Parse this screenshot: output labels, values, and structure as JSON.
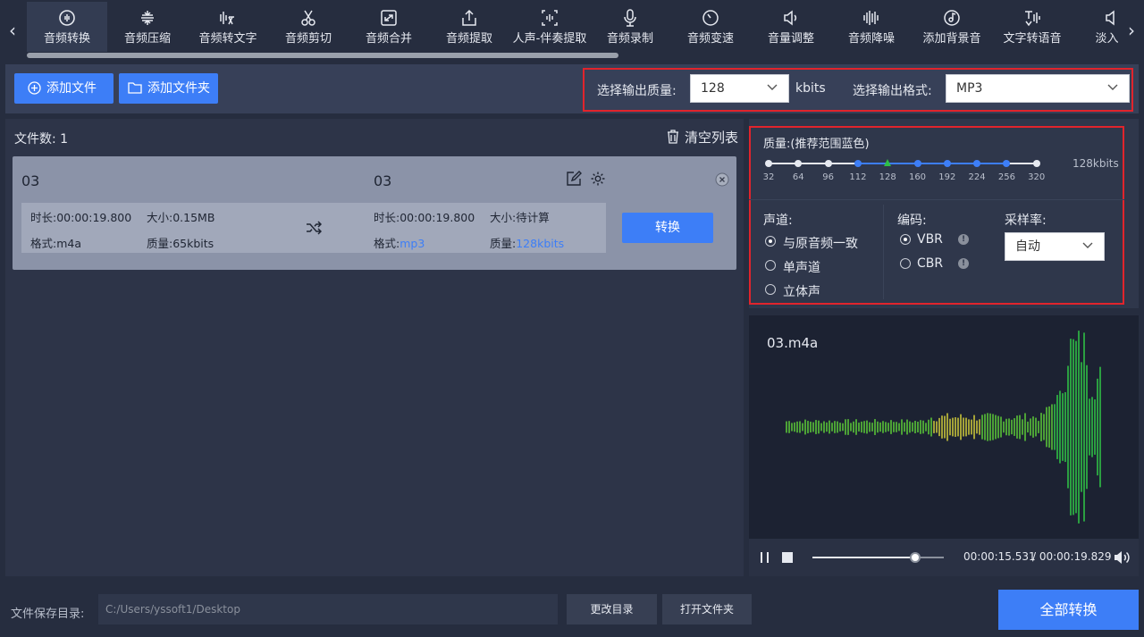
{
  "toolbar": {
    "tools": [
      {
        "label": "音频转换",
        "icon": "audio-convert-icon"
      },
      {
        "label": "音频压缩",
        "icon": "compress-icon"
      },
      {
        "label": "音频转文字",
        "icon": "speech-to-text-icon"
      },
      {
        "label": "音频剪切",
        "icon": "scissors-icon"
      },
      {
        "label": "音频合并",
        "icon": "merge-icon"
      },
      {
        "label": "音频提取",
        "icon": "upload-icon"
      },
      {
        "label": "人声-伴奏提取",
        "icon": "vocal-extract-icon"
      },
      {
        "label": "音频录制",
        "icon": "microphone-icon"
      },
      {
        "label": "音频变速",
        "icon": "speed-clock-icon"
      },
      {
        "label": "音量调整",
        "icon": "speaker-icon"
      },
      {
        "label": "音频降噪",
        "icon": "waveform-bars-icon"
      },
      {
        "label": "添加背景音",
        "icon": "music-disc-icon"
      },
      {
        "label": "文字转语音",
        "icon": "text-to-speech-icon"
      },
      {
        "label": "淡入淡",
        "icon": "fade-icon"
      }
    ]
  },
  "actions": {
    "add_file": "添加文件",
    "add_folder": "添加文件夹",
    "quality_label": "选择输出质量:",
    "quality_value": "128",
    "quality_unit": "kbits",
    "format_label": "选择输出格式:",
    "format_value": "MP3"
  },
  "filelist": {
    "count_label": "文件数:",
    "count": "1",
    "clear_label": "清空列表",
    "items": [
      {
        "src_name": "03",
        "dst_name": "03",
        "src_duration": "时长:00:00:19.800",
        "src_size": "大小:0.15MB",
        "src_format_label": "格式:",
        "src_format": "m4a",
        "src_quality_label": "质量:",
        "src_quality": "65kbits",
        "dst_duration": "时长:00:00:19.800",
        "dst_size": "大小:待计算",
        "dst_format_label": "格式:",
        "dst_format": "mp3",
        "dst_quality_label": "质量:",
        "dst_quality": "128kbits",
        "convert_label": "转换"
      }
    ]
  },
  "settings": {
    "quality_title": "质量:(推荐范围蓝色)",
    "current_quality": "128kbits",
    "ticks": [
      "32",
      "64",
      "96",
      "112",
      "128",
      "160",
      "192",
      "224",
      "256",
      "320"
    ],
    "selected_tick": "128",
    "channel_label": "声道:",
    "channels": [
      {
        "label": "与原音频一致",
        "selected": true
      },
      {
        "label": "单声道",
        "selected": false
      },
      {
        "label": "立体声",
        "selected": false
      }
    ],
    "encoding_label": "编码:",
    "encodings": [
      {
        "label": "VBR",
        "selected": true
      },
      {
        "label": "CBR",
        "selected": false
      }
    ],
    "samplerate_label": "采样率:",
    "samplerate_value": "自动"
  },
  "player": {
    "filename": "03.m4a",
    "time_current": "00:00:15.531",
    "time_total": "/ 00:00:19.829",
    "progress": 0.78
  },
  "bottom": {
    "save_label": "文件保存目录:",
    "save_path": "C:/Users/yssoft1/Desktop",
    "change_dir": "更改目录",
    "open_folder": "打开文件夹",
    "convert_all": "全部转换"
  },
  "colors": {
    "accent": "#3d7ef7",
    "highlight_box": "#e1242c",
    "selected_tick": "#2fbf45"
  }
}
